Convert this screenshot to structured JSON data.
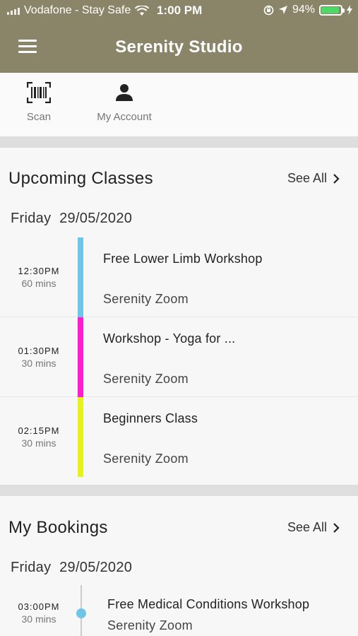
{
  "status_bar": {
    "carrier": "Vodafone - Stay Safe",
    "time": "1:00 PM",
    "battery": "94%",
    "battery_color": "#4cd964"
  },
  "header": {
    "title": "Serenity Studio",
    "menu_icon": "hamburger-menu-icon",
    "background": "#8a8568"
  },
  "quick_actions": [
    {
      "label": "Scan",
      "icon": "barcode-scan-icon"
    },
    {
      "label": "My Account",
      "icon": "person-icon"
    }
  ],
  "upcoming": {
    "title": "Upcoming Classes",
    "see_all": "See All",
    "date_day": "Friday",
    "date": "29/05/2020",
    "classes": [
      {
        "time": "12:30PM",
        "duration": "60 mins",
        "name": "Free Lower Limb Workshop",
        "location": "Serenity  Zoom",
        "color": "#6ec6e7"
      },
      {
        "time": "01:30PM",
        "duration": "30 mins",
        "name": "Workshop - Yoga for ...",
        "location": "Serenity  Zoom",
        "color": "#ff1ecf"
      },
      {
        "time": "02:15PM",
        "duration": "30 mins",
        "name": "Beginners Class",
        "location": "Serenity  Zoom",
        "color": "#e6f21c"
      }
    ]
  },
  "bookings": {
    "title": "My Bookings",
    "see_all": "See All",
    "date_day": "Friday",
    "date": "29/05/2020",
    "items": [
      {
        "time": "03:00PM",
        "duration": "30 mins",
        "name": "Free Medical Conditions Workshop",
        "location": "Serenity  Zoom",
        "dot_color": "#6ec6e7"
      }
    ]
  }
}
